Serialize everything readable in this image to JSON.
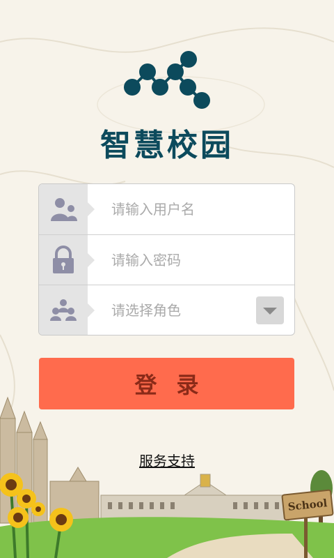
{
  "app": {
    "title": "智慧校园"
  },
  "form": {
    "username_placeholder": "请输入用户名",
    "password_placeholder": "请输入密码",
    "role_placeholder": "请选择角色"
  },
  "actions": {
    "login_label": "登录",
    "support_label": "服务支持"
  },
  "scene": {
    "sign_text": "School"
  },
  "icons": {
    "logo": "dots-logo-icon",
    "username": "user-group-icon",
    "password": "lock-icon",
    "role": "people-icon",
    "dropdown": "triangle-down-icon"
  },
  "colors": {
    "brand": "#0c4a5c",
    "login_button": "#ff6b4d",
    "login_text": "#8a2a18",
    "icon_bg": "#e4e4e4",
    "icon_fg": "#8e8ea6"
  }
}
